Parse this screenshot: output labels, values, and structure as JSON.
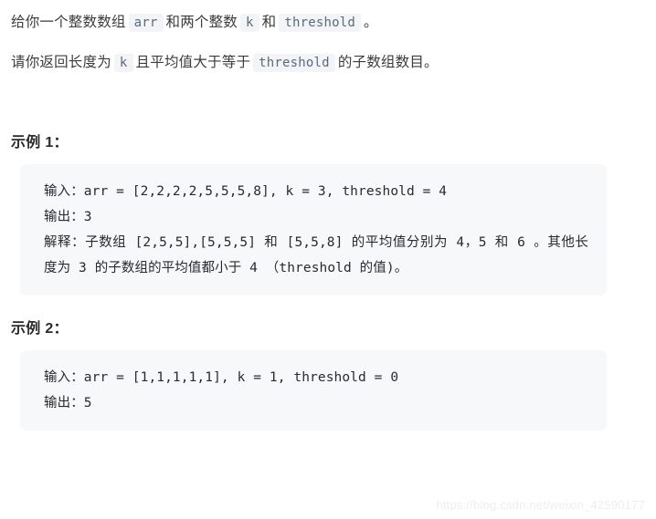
{
  "description": {
    "paragraph1": {
      "seg1": "给你一个整数数组",
      "code1": "arr",
      "seg2": "和两个整数",
      "code2": "k",
      "seg3": "和",
      "code3": "threshold",
      "seg4": "。"
    },
    "paragraph2": {
      "seg1": "请你返回长度为",
      "code1": "k",
      "seg2": "且平均值大于等于",
      "code2": "threshold",
      "seg3": "的子数组数目。"
    }
  },
  "examples": [
    {
      "heading": "示例 1：",
      "lines": [
        "输入：arr = [2,2,2,2,5,5,5,8], k = 3, threshold = 4",
        "输出：3",
        "解释：子数组 [2,5,5],[5,5,5] 和 [5,5,8] 的平均值分别为 4，5 和 6 。其他长度为 3 的子数组的平均值都小于 4 （threshold 的值)。"
      ]
    },
    {
      "heading": "示例 2：",
      "lines": [
        "输入：arr = [1,1,1,1,1], k = 1, threshold = 0",
        "输出：5"
      ]
    }
  ],
  "watermark": "https://blog.csdn.net/weixin_42590177",
  "colors": {
    "code_block_bg": "#f7f8fa",
    "inline_chip_bg": "#f2f4f7",
    "inline_chip_text": "#5c6b7a",
    "body_text": "#3c3c3c",
    "code_text": "#262a33",
    "watermark_text": "#eceef1"
  }
}
